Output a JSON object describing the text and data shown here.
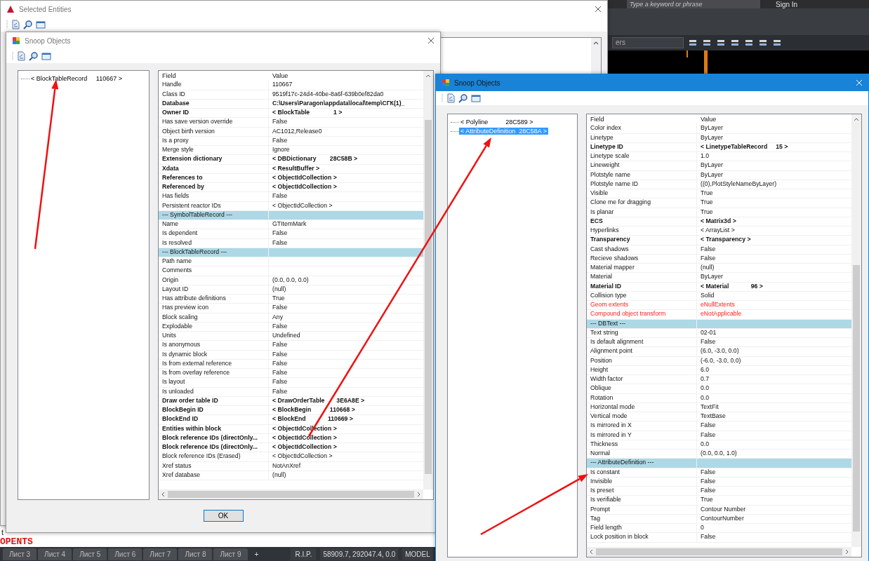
{
  "background_app": {
    "search": {
      "placeholder": "Type a keyword or phrase"
    },
    "sign_in": "Sign In",
    "layer_field": "ers",
    "command_history": "t",
    "command_line": "OPENTS",
    "layout_tabs": [
      "Лист 3",
      "Лист 4",
      "Лист 5",
      "Лист 6",
      "Лист 7",
      "Лист 8",
      "Лист 9"
    ],
    "add_tab": "+",
    "status": {
      "rip": "R.I.P.",
      "coordinates": "58909.7, 292047.4, 0.0",
      "space": "MODEL"
    }
  },
  "windows": [
    {
      "title": "Selected Entities",
      "active": false
    },
    {
      "title": "Snoop Objects",
      "active": false,
      "tree": [
        {
          "label": "< BlockTableRecord     110667 >",
          "selected": false
        }
      ],
      "table": {
        "columns": [
          "Field",
          "Value"
        ],
        "rows": [
          {
            "field": "Handle",
            "value": "110667",
            "kind": "normal"
          },
          {
            "field": "Class ID",
            "value": "9519f17c-24d4-40be-8a6f-639b0ef82da0",
            "kind": "normal"
          },
          {
            "field": "Database",
            "value": "C:\\Users\\Paragon\\appdata\\local\\temp\\СГК(1)_",
            "kind": "bold"
          },
          {
            "field": "Owner ID",
            "value": "< BlockTable              1 >",
            "kind": "bold"
          },
          {
            "field": "Has save version override",
            "value": "False",
            "kind": "normal"
          },
          {
            "field": "Object birth version",
            "value": "AC1012,Release0",
            "kind": "normal"
          },
          {
            "field": "Is a proxy",
            "value": "False",
            "kind": "normal"
          },
          {
            "field": "Merge style",
            "value": "Ignore",
            "kind": "normal"
          },
          {
            "field": "Extension dictionary",
            "value": "< DBDictionary        28C58B >",
            "kind": "bold"
          },
          {
            "field": "Xdata",
            "value": "< ResultBuffer >",
            "kind": "bold"
          },
          {
            "field": "References to",
            "value": "< ObjectIdCollection >",
            "kind": "bold"
          },
          {
            "field": "Referenced by",
            "value": "< ObjectIdCollection >",
            "kind": "bold"
          },
          {
            "field": "Has fields",
            "value": "False",
            "kind": "normal"
          },
          {
            "field": "Persistent reactor IDs",
            "value": "< ObjectIdCollection >",
            "kind": "normal"
          },
          {
            "field": "--- SymbolTableRecord ---",
            "kind": "section"
          },
          {
            "field": "Name",
            "value": "GTItemMark",
            "kind": "normal"
          },
          {
            "field": "Is dependent",
            "value": "False",
            "kind": "normal"
          },
          {
            "field": "Is resolved",
            "value": "False",
            "kind": "normal"
          },
          {
            "field": "--- BlockTableRecord ---",
            "kind": "section"
          },
          {
            "field": "Path name",
            "kind": "normal"
          },
          {
            "field": "Comments",
            "kind": "normal"
          },
          {
            "field": "Origin",
            "value": "(0.0, 0.0, 0.0)",
            "kind": "normal"
          },
          {
            "field": "Layout ID",
            "value": "(null)",
            "kind": "normal"
          },
          {
            "field": "Has attribute definitions",
            "value": "True",
            "kind": "normal"
          },
          {
            "field": "Has preview icon",
            "value": "False",
            "kind": "normal"
          },
          {
            "field": "Block scaling",
            "value": "Any",
            "kind": "normal"
          },
          {
            "field": "Explodable",
            "value": "False",
            "kind": "normal"
          },
          {
            "field": "Units",
            "value": "Undefined",
            "kind": "normal"
          },
          {
            "field": "Is anonymous",
            "value": "False",
            "kind": "normal"
          },
          {
            "field": "Is dynamic block",
            "value": "False",
            "kind": "normal"
          },
          {
            "field": "Is from external reference",
            "value": "False",
            "kind": "normal"
          },
          {
            "field": "Is from overlay reference",
            "value": "False",
            "kind": "normal"
          },
          {
            "field": "Is layout",
            "value": "False",
            "kind": "normal"
          },
          {
            "field": "Is unloaded",
            "value": "False",
            "kind": "normal"
          },
          {
            "field": "Draw order table ID",
            "value": "< DrawOrderTable       3E6A8E >",
            "kind": "bold"
          },
          {
            "field": "BlockBegin ID",
            "value": "< BlockBegin           110668 >",
            "kind": "bold"
          },
          {
            "field": "BlockEnd ID",
            "value": "< BlockEnd             110669 >",
            "kind": "bold"
          },
          {
            "field": "Entities within block",
            "value": "< ObjectIdCollection >",
            "kind": "bold"
          },
          {
            "field": "Block reference IDs (directOnly...",
            "value": "< ObjectIdCollection >",
            "kind": "bold"
          },
          {
            "field": "Block reference IDs (directOnly...",
            "value": "< ObjectIdCollection >",
            "kind": "bold"
          },
          {
            "field": "Block reference IDs (Erased)",
            "value": "< ObjectIdCollection >",
            "kind": "normal"
          },
          {
            "field": "Xref status",
            "value": "NotAnXref",
            "kind": "normal"
          },
          {
            "field": "Xref database",
            "value": "(null)",
            "kind": "normal"
          }
        ]
      },
      "ok_button": "OK"
    },
    {
      "title": "Snoop Objects",
      "active": true,
      "tree": [
        {
          "label": "< Polyline          28C589 >",
          "selected": false
        },
        {
          "label": "< AttributeDefinition  28C58A >",
          "selected": true
        }
      ],
      "table": {
        "columns": [
          "Field",
          "Value"
        ],
        "rows": [
          {
            "field": "Color index",
            "value": "ByLayer",
            "kind": "normal"
          },
          {
            "field": "Linetype",
            "value": "ByLayer",
            "kind": "normal"
          },
          {
            "field": "Linetype ID",
            "value": "< LinetypeTableRecord     15 >",
            "kind": "bold"
          },
          {
            "field": "Linetype scale",
            "value": "1.0",
            "kind": "normal"
          },
          {
            "field": "Lineweight",
            "value": "ByLayer",
            "kind": "normal"
          },
          {
            "field": "Plotstyle name",
            "value": "ByLayer",
            "kind": "normal"
          },
          {
            "field": "Plotstyle name ID",
            "value": "((0),PlotStyleNameByLayer)",
            "kind": "normal"
          },
          {
            "field": "Visible",
            "value": "True",
            "kind": "normal"
          },
          {
            "field": "Clone me for dragging",
            "value": "True",
            "kind": "normal"
          },
          {
            "field": "Is planar",
            "value": "True",
            "kind": "normal"
          },
          {
            "field": "ECS",
            "value": "< Matrix3d >",
            "kind": "bold"
          },
          {
            "field": "Hyperlinks",
            "value": "< ArrayList >",
            "kind": "normal"
          },
          {
            "field": "Transparency",
            "value": "< Transparency >",
            "kind": "bold"
          },
          {
            "field": "Cast shadows",
            "value": "False",
            "kind": "normal"
          },
          {
            "field": "Recieve shadows",
            "value": "False",
            "kind": "normal"
          },
          {
            "field": "Material mapper",
            "value": "(null)",
            "kind": "normal"
          },
          {
            "field": "Material",
            "value": "ByLayer",
            "kind": "normal"
          },
          {
            "field": "Material ID",
            "value": "< Material             96 >",
            "kind": "bold"
          },
          {
            "field": "Collision type",
            "value": "Solid",
            "kind": "normal"
          },
          {
            "field": "Geom extents",
            "value": "eNullExtents",
            "kind": "error"
          },
          {
            "field": "Compound object transform",
            "value": "eNotApplicable",
            "kind": "error"
          },
          {
            "field": "--- DBText ---",
            "kind": "section"
          },
          {
            "field": "Text string",
            "value": "02-01",
            "kind": "normal"
          },
          {
            "field": "Is default alignment",
            "value": "False",
            "kind": "normal"
          },
          {
            "field": "Alignment point",
            "value": "(6.0, -3.0, 0.0)",
            "kind": "normal"
          },
          {
            "field": "Position",
            "value": "(-6.0, -3.0, 0.0)",
            "kind": "normal"
          },
          {
            "field": "Height",
            "value": "6.0",
            "kind": "normal"
          },
          {
            "field": "Width factor",
            "value": "0.7",
            "kind": "normal"
          },
          {
            "field": "Oblique",
            "value": "0.0",
            "kind": "normal"
          },
          {
            "field": "Rotation",
            "value": "0.0",
            "kind": "normal"
          },
          {
            "field": "Horizontal mode",
            "value": "TextFit",
            "kind": "normal"
          },
          {
            "field": "Vertical mode",
            "value": "TextBase",
            "kind": "normal"
          },
          {
            "field": "Is mirrored in X",
            "value": "False",
            "kind": "normal"
          },
          {
            "field": "Is mirrored in Y",
            "value": "False",
            "kind": "normal"
          },
          {
            "field": "Thickness",
            "value": "0.0",
            "kind": "normal"
          },
          {
            "field": "Normal",
            "value": "(0.0, 0.0, 1.0)",
            "kind": "normal"
          },
          {
            "field": "--- AttributeDefinition ---",
            "kind": "section"
          },
          {
            "field": "Is constant",
            "value": "False",
            "kind": "normal"
          },
          {
            "field": "Invisible",
            "value": "False",
            "kind": "normal"
          },
          {
            "field": "Is preset",
            "value": "False",
            "kind": "normal"
          },
          {
            "field": "Is verifiable",
            "value": "True",
            "kind": "normal"
          },
          {
            "field": "Prompt",
            "value": "Contour Number",
            "kind": "normal"
          },
          {
            "field": "Tag",
            "value": "ContourNumber",
            "kind": "normal"
          },
          {
            "field": "Field length",
            "value": "0",
            "kind": "normal"
          },
          {
            "field": "Lock position in block",
            "value": "False",
            "kind": "normal"
          }
        ]
      }
    }
  ]
}
